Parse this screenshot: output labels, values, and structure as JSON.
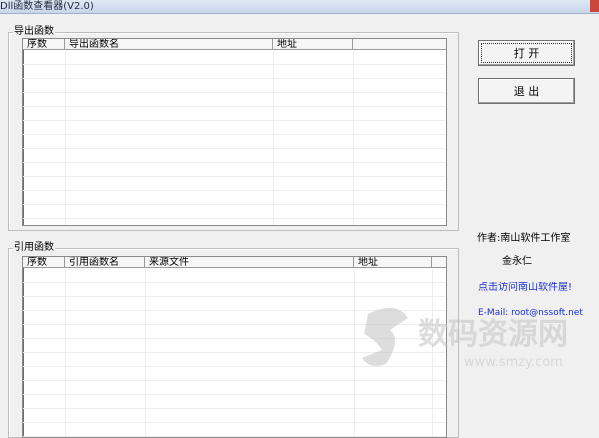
{
  "window": {
    "title": "Dll函数查看器(V2.0)"
  },
  "export_group": {
    "label": "导出函数",
    "columns": [
      "序数",
      "导出函数名",
      "地址",
      ""
    ]
  },
  "import_group": {
    "label": "引用函数",
    "columns": [
      "序数",
      "引用函数名",
      "来源文件",
      "地址",
      ""
    ]
  },
  "buttons": {
    "open": "打 开",
    "exit": "退 出"
  },
  "info": {
    "author": "作者:南山软件工作室",
    "name": "金永仁",
    "visit_link": "点击访问南山软件屋!",
    "email": "E-Mail: root@nssoft.net"
  },
  "watermark": {
    "main": "数码资源网",
    "url": "www.smzy.com"
  },
  "colors": {
    "link": "#1a2fd1",
    "watermark": "#c3c3c3"
  },
  "icons": {
    "close": "close-icon"
  }
}
